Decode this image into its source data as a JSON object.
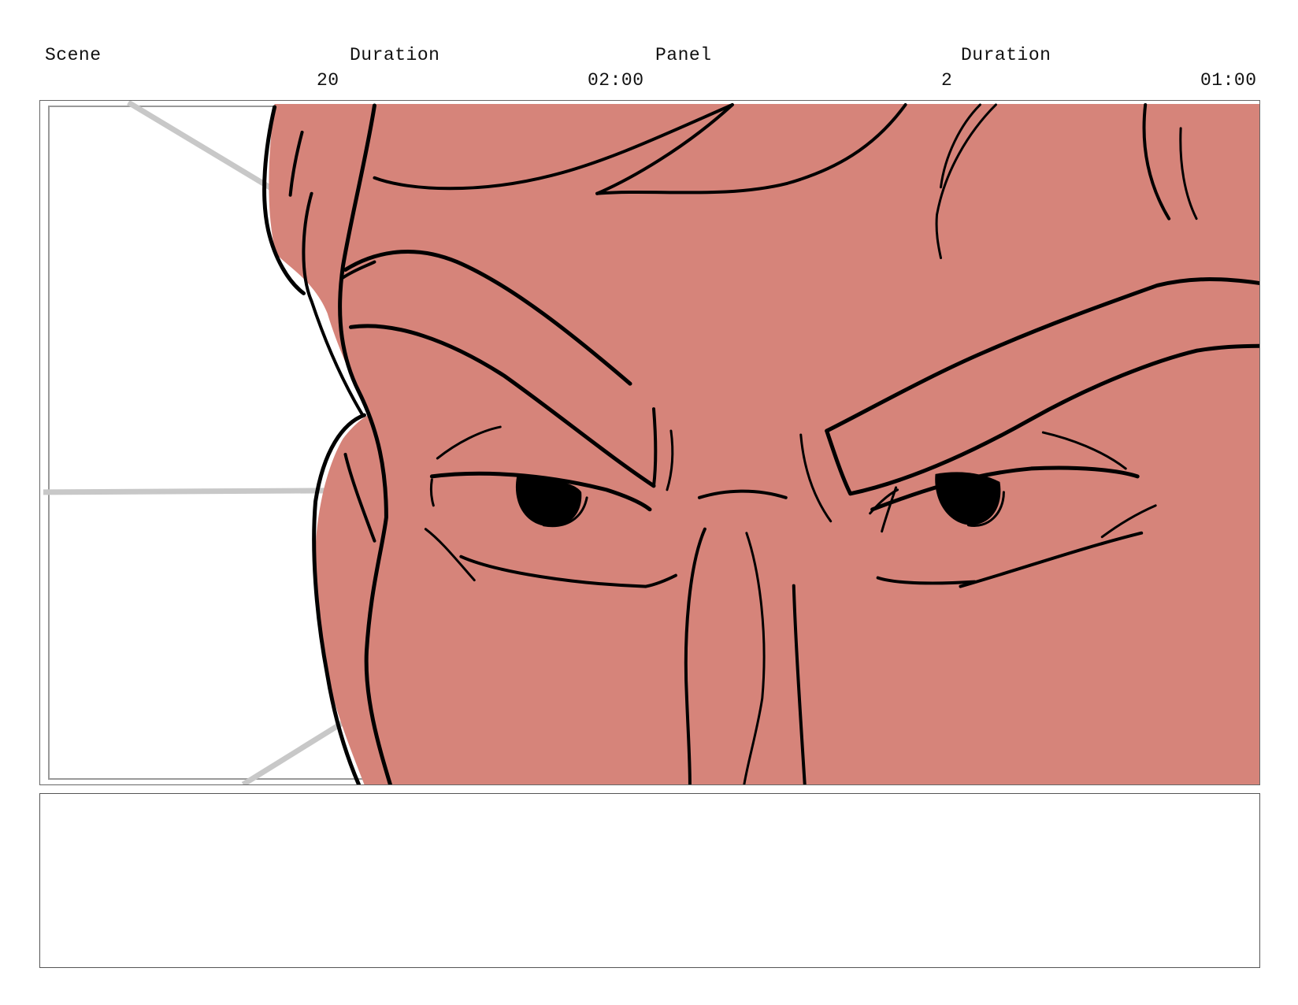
{
  "header": {
    "scene_label": "Scene",
    "scene_duration_label": "Duration",
    "panel_label": "Panel",
    "panel_duration_label": "Duration",
    "scene_number": "20",
    "scene_duration": "02:00",
    "panel_number": "2",
    "panel_duration": "01:00"
  },
  "panel": {
    "skin_color": "#D6847A",
    "line_color": "#000000",
    "guide_color": "#C8C8C8"
  },
  "notes": {
    "text": ""
  }
}
